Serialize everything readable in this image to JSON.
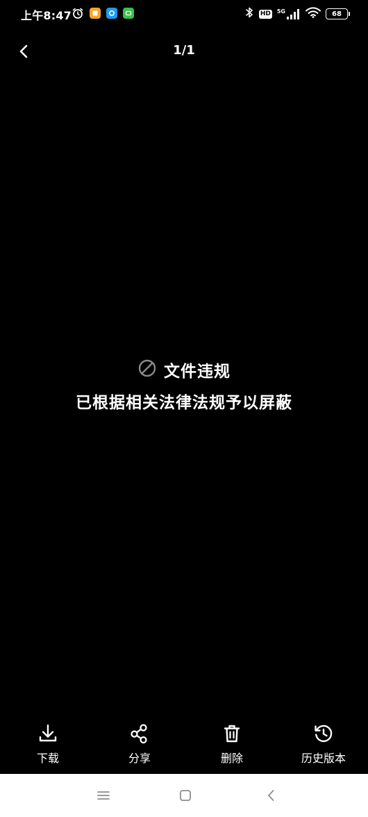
{
  "status_bar": {
    "time": "上午8:47",
    "hd": "HD",
    "network": "5G",
    "battery": "68"
  },
  "header": {
    "page_indicator": "1/1"
  },
  "content": {
    "title": "文件违规",
    "description": "已根据相关法律法规予以屏蔽"
  },
  "actions": [
    {
      "label": "下载",
      "icon": "download-icon"
    },
    {
      "label": "分享",
      "icon": "share-icon"
    },
    {
      "label": "删除",
      "icon": "trash-icon"
    },
    {
      "label": "历史版本",
      "icon": "history-icon"
    }
  ],
  "colors": {
    "background": "#000000",
    "nav_bar": "#ffffff",
    "blocked_icon": "#8a8a8a"
  }
}
